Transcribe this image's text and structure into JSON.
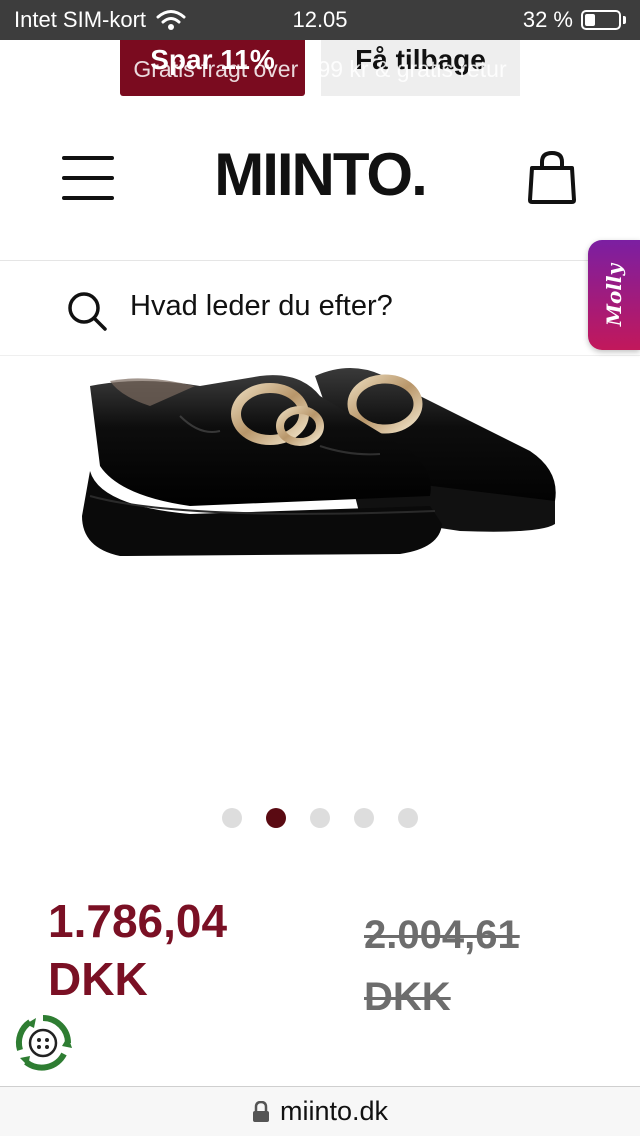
{
  "status_bar": {
    "carrier": "Intet SIM-kort",
    "time": "12.05",
    "battery_percent": "32 %",
    "battery_level": 0.32
  },
  "promo": {
    "save_label": "Spar 11%",
    "back_label": "Få tilbage",
    "ticker_text": "Gratis fragt over 499 kr & gratis retur"
  },
  "header": {
    "logo": "MIINTO."
  },
  "search": {
    "placeholder": "Hvad leder du efter?"
  },
  "assistant": {
    "label": "Molly",
    "gradient": [
      "#7b1fa2",
      "#c2185b"
    ]
  },
  "carousel": {
    "dot_count": 5,
    "active_index": 1
  },
  "price": {
    "current": "1.786,04",
    "current_currency": "DKK",
    "original": "2.004,61",
    "original_currency": "DKK",
    "current_color": "#7a1024",
    "original_color": "#6d6d6d"
  },
  "browser": {
    "url": "miinto.dk"
  },
  "colors": {
    "brand_accent": "#7a0b1f",
    "status_bar_bg": "#3d3d3d"
  }
}
